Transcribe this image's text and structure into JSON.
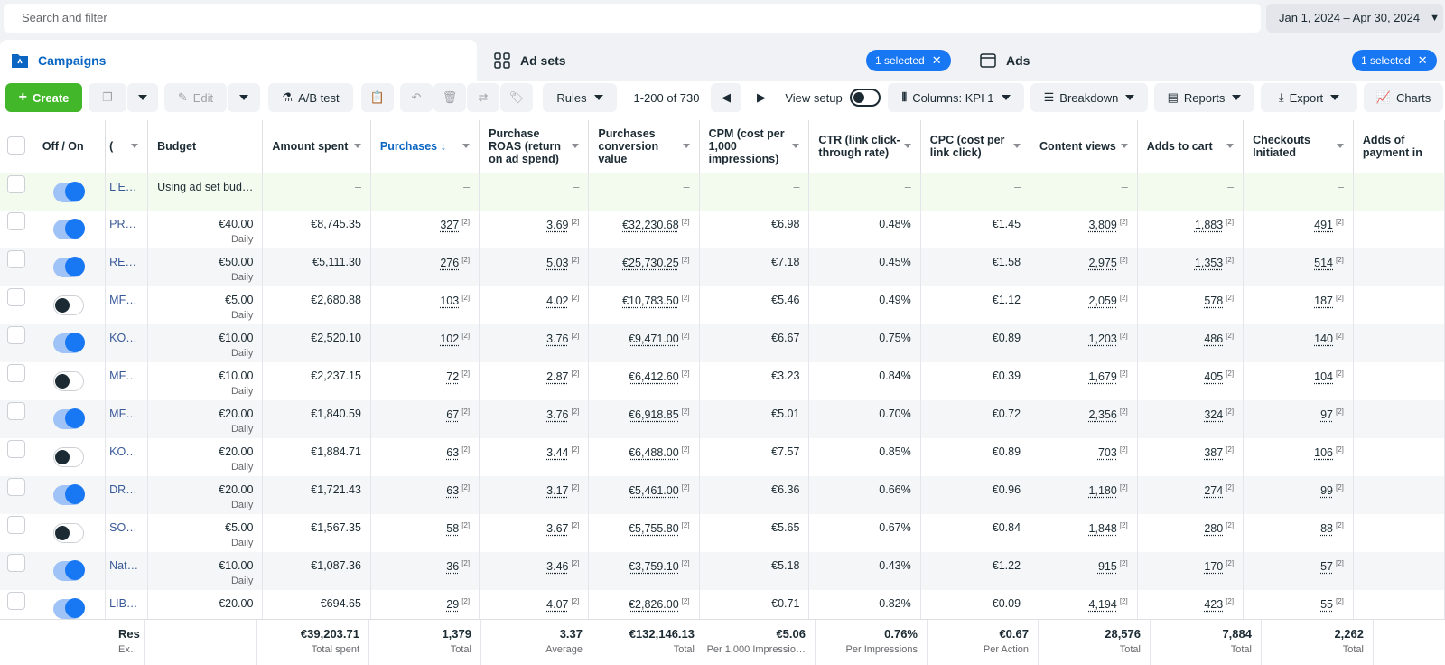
{
  "search": {
    "placeholder": "Search and filter"
  },
  "date_range": "Jan 1, 2024 – Apr 30, 2024",
  "tabs": [
    {
      "label": "Campaigns",
      "icon": "folder-icon"
    },
    {
      "label": "Ad sets",
      "icon": "grid-icon",
      "badge": "1 selected"
    },
    {
      "label": "Ads",
      "icon": "ad-icon",
      "badge": "1 selected"
    }
  ],
  "toolbar": {
    "create": "Create",
    "edit": "Edit",
    "ab_test": "A/B test",
    "rules": "Rules",
    "pagination": "1-200 of 730",
    "view_setup": "View setup",
    "columns": "Columns: KPI 1",
    "breakdown": "Breakdown",
    "reports": "Reports",
    "export": "Export",
    "charts": "Charts"
  },
  "columns": {
    "off_on": "Off / On",
    "name": "(",
    "budget": "Budget",
    "amount_spent": "Amount spent",
    "purchases": "Purchases",
    "roas": "Purchase ROAS (return on ad spend)",
    "conv_value": "Purchases conversion value",
    "cpm": "CPM (cost per 1,000 impressions)",
    "ctr": "CTR (link click-through rate)",
    "cpc": "CPC (cost per link click)",
    "content_views": "Content views",
    "adds_to_cart": "Adds to cart",
    "checkouts": "Checkouts Initiated",
    "payment": "Adds of payment in"
  },
  "footnote": "[2]",
  "summary_row": {
    "name": "L'E…",
    "budget": "Using ad set bud…",
    "dash": "–",
    "on": true
  },
  "rows": [
    {
      "on": true,
      "name": "PR…",
      "budget": "€40.00",
      "period": "Daily",
      "spent": "€8,745.35",
      "purchases": "327",
      "roas": "3.69",
      "value": "€32,230.68",
      "cpm": "€6.98",
      "ctr": "0.48%",
      "cpc": "€1.45",
      "views": "3,809",
      "cart": "1,883",
      "checkouts": "491"
    },
    {
      "on": true,
      "name": "RE…",
      "budget": "€50.00",
      "period": "Daily",
      "spent": "€5,111.30",
      "purchases": "276",
      "roas": "5.03",
      "value": "€25,730.25",
      "cpm": "€7.18",
      "ctr": "0.45%",
      "cpc": "€1.58",
      "views": "2,975",
      "cart": "1,353",
      "checkouts": "514"
    },
    {
      "on": false,
      "name": "MF…",
      "budget": "€5.00",
      "period": "Daily",
      "spent": "€2,680.88",
      "purchases": "103",
      "roas": "4.02",
      "value": "€10,783.50",
      "cpm": "€5.46",
      "ctr": "0.49%",
      "cpc": "€1.12",
      "views": "2,059",
      "cart": "578",
      "checkouts": "187"
    },
    {
      "on": true,
      "name": "KO…",
      "budget": "€10.00",
      "period": "Daily",
      "spent": "€2,520.10",
      "purchases": "102",
      "roas": "3.76",
      "value": "€9,471.00",
      "cpm": "€6.67",
      "ctr": "0.75%",
      "cpc": "€0.89",
      "views": "1,203",
      "cart": "486",
      "checkouts": "140"
    },
    {
      "on": false,
      "name": "MF…",
      "budget": "€10.00",
      "period": "Daily",
      "spent": "€2,237.15",
      "purchases": "72",
      "roas": "2.87",
      "value": "€6,412.60",
      "cpm": "€3.23",
      "ctr": "0.84%",
      "cpc": "€0.39",
      "views": "1,679",
      "cart": "405",
      "checkouts": "104"
    },
    {
      "on": true,
      "name": "MF…",
      "budget": "€20.00",
      "period": "Daily",
      "spent": "€1,840.59",
      "purchases": "67",
      "roas": "3.76",
      "value": "€6,918.85",
      "cpm": "€5.01",
      "ctr": "0.70%",
      "cpc": "€0.72",
      "views": "2,356",
      "cart": "324",
      "checkouts": "97"
    },
    {
      "on": false,
      "name": "KO…",
      "budget": "€20.00",
      "period": "Daily",
      "spent": "€1,884.71",
      "purchases": "63",
      "roas": "3.44",
      "value": "€6,488.00",
      "cpm": "€7.57",
      "ctr": "0.85%",
      "cpc": "€0.89",
      "views": "703",
      "cart": "387",
      "checkouts": "106"
    },
    {
      "on": true,
      "name": "DR…",
      "budget": "€20.00",
      "period": "Daily",
      "spent": "€1,721.43",
      "purchases": "63",
      "roas": "3.17",
      "value": "€5,461.00",
      "cpm": "€6.36",
      "ctr": "0.66%",
      "cpc": "€0.96",
      "views": "1,180",
      "cart": "274",
      "checkouts": "99"
    },
    {
      "on": false,
      "name": "SO…",
      "budget": "€5.00",
      "period": "Daily",
      "spent": "€1,567.35",
      "purchases": "58",
      "roas": "3.67",
      "value": "€5,755.80",
      "cpm": "€5.65",
      "ctr": "0.67%",
      "cpc": "€0.84",
      "views": "1,848",
      "cart": "280",
      "checkouts": "88"
    },
    {
      "on": true,
      "name": "Nat…",
      "budget": "€10.00",
      "period": "Daily",
      "spent": "€1,087.36",
      "purchases": "36",
      "roas": "3.46",
      "value": "€3,759.10",
      "cpm": "€5.18",
      "ctr": "0.43%",
      "cpc": "€1.22",
      "views": "915",
      "cart": "170",
      "checkouts": "57"
    },
    {
      "on": true,
      "name": "LIB…",
      "budget": "€20.00",
      "period": "",
      "spent": "€694.65",
      "purchases": "29",
      "roas": "4.07",
      "value": "€2,826.00",
      "cpm": "€0.71",
      "ctr": "0.82%",
      "cpc": "€0.09",
      "views": "4,194",
      "cart": "423",
      "checkouts": "55"
    }
  ],
  "totals": {
    "name": "Res",
    "name_sub": "Ex…",
    "spent": {
      "value": "€39,203.71",
      "label": "Total spent"
    },
    "purchases": {
      "value": "1,379",
      "label": "Total"
    },
    "roas": {
      "value": "3.37",
      "label": "Average"
    },
    "value": {
      "value": "€132,146.13",
      "label": "Total"
    },
    "cpm": {
      "value": "€5.06",
      "label": "Per 1,000 Impressio…"
    },
    "ctr": {
      "value": "0.76%",
      "label": "Per Impressions"
    },
    "cpc": {
      "value": "€0.67",
      "label": "Per Action"
    },
    "views": {
      "value": "28,576",
      "label": "Total"
    },
    "cart": {
      "value": "7,884",
      "label": "Total"
    },
    "checkouts": {
      "value": "2,262",
      "label": "Total"
    }
  }
}
